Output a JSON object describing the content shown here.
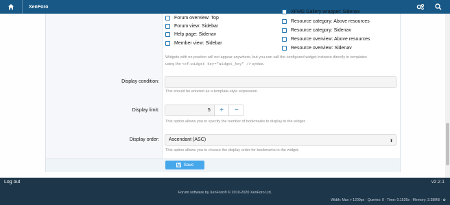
{
  "topbar": {
    "brand": "XenForo"
  },
  "positions_left": [
    {
      "label": "Forum overview: Top"
    },
    {
      "label": "Forum view: Sidebar"
    },
    {
      "label": "Help page: Sidenav"
    },
    {
      "label": "Member view: Sidebar"
    }
  ],
  "positions_right": [
    {
      "label": "XFMG Gallery wrapper: Sidenav"
    },
    {
      "label": "Resource category: Above resources"
    },
    {
      "label": "Resource category: Sidenav"
    },
    {
      "label": "Resource overview: Above resources"
    },
    {
      "label": "Resource overview: Sidenav"
    }
  ],
  "positions_hint": {
    "line1": "Widgets with no position will not appear anywhere, but you can call the configured widget instance directly in templates",
    "line2_pre": "using the",
    "line2_code": "<xf:widget key=\"widget_key\" />",
    "line2_post": "syntax."
  },
  "display_condition": {
    "label": "Display condition:",
    "value": "",
    "hint": "This should be entered as a template-style expression."
  },
  "display_limit": {
    "label": "Display limit:",
    "value": "5",
    "plus": "+",
    "minus": "−",
    "hint": "This option allows you to specify the number of bookmarks to display in the widget."
  },
  "display_order": {
    "label": "Display order:",
    "selected": "Ascendant (ASC)",
    "hint": "This option allows you to choose the display order for bookmarks in the widget."
  },
  "save_label": "Save",
  "footer": {
    "logout": "Log out",
    "version": "v2.2.1",
    "copyright": "Forum software by XenForo® © 2010-2020 XenForo Ltd.",
    "debug": "Width: Max > 1200px · Queries: 9 · Time: 0.1526s · Memory: 3.38MB · ✿"
  }
}
